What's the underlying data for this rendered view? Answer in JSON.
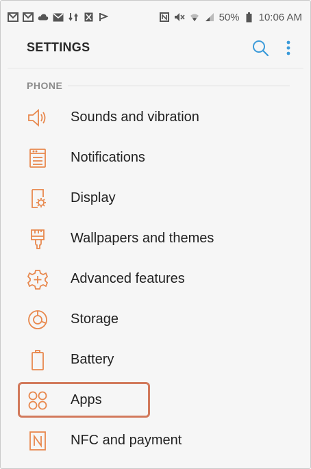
{
  "status_bar": {
    "battery": "50%",
    "time": "10:06 AM"
  },
  "header": {
    "title": "SETTINGS"
  },
  "section": {
    "label": "PHONE"
  },
  "items": [
    {
      "label": "Sounds and vibration",
      "icon": "speaker-icon"
    },
    {
      "label": "Notifications",
      "icon": "notifications-icon"
    },
    {
      "label": "Display",
      "icon": "display-icon"
    },
    {
      "label": "Wallpapers and themes",
      "icon": "paintbrush-icon"
    },
    {
      "label": "Advanced features",
      "icon": "advanced-features-icon"
    },
    {
      "label": "Storage",
      "icon": "storage-icon"
    },
    {
      "label": "Battery",
      "icon": "battery-icon"
    },
    {
      "label": "Apps",
      "icon": "apps-icon"
    },
    {
      "label": "NFC and payment",
      "icon": "nfc-icon"
    }
  ],
  "colors": {
    "accent": "#e8884d",
    "search": "#3a9ad9",
    "highlight": "#d27a5c"
  }
}
